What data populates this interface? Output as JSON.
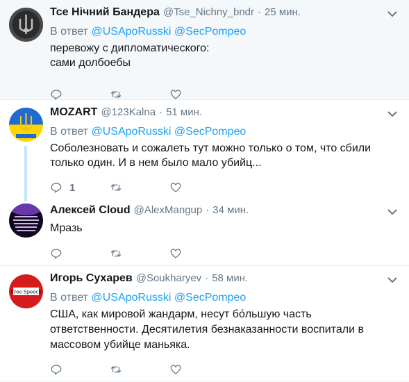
{
  "tweets": [
    {
      "name": "Тсе Нічний Бандера",
      "handle": "@Tse_Nichny_bndr",
      "time": "25 мин.",
      "reply_prefix": "В ответ",
      "mentions": [
        "@USApoRusski",
        "@SecPompeo"
      ],
      "text": "перевожу с дипломатического:\nсами долбоебы",
      "reply_count": "",
      "avatar": "dark-trident-avatar"
    },
    {
      "name": "MOZART",
      "handle": "@123Kalna",
      "time": "51 мин.",
      "reply_prefix": "В ответ",
      "mentions": [
        "@USApoRusski",
        "@SecPompeo"
      ],
      "text": "Соболезновать и сожалеть тут можно только о том, что сбили только один. И в нем было мало убийц...",
      "reply_count": "1",
      "avatar": "ukraine-flag-trident-avatar"
    },
    {
      "name": "Алексей Cloud",
      "handle": "@AlexMangup",
      "time": "34 мин.",
      "reply_prefix": "",
      "mentions": [],
      "text": "Мразь",
      "reply_count": "",
      "avatar": "purple-text-avatar"
    },
    {
      "name": "Игорь Сухарев",
      "handle": "@Soukharyev",
      "time": "58 мин.",
      "reply_prefix": "В ответ",
      "mentions": [
        "@USApoRusski",
        "@SecPompeo"
      ],
      "text": "США, как мировой жандарм, несут бо́льшую часть ответственности. Десятилетия безнаказанности воспитали в массовом убийце маньяка.",
      "reply_count": "",
      "avatar": "free-speech-avatar"
    }
  ],
  "colors": {
    "accent": "#1da1f2",
    "muted": "#657786",
    "highlight_bg": "#f5f8fa",
    "thread_line": "#c4e6fb"
  },
  "avatar_text": {
    "free_speech": "Free Speech"
  },
  "icons": [
    "reply-icon",
    "retweet-icon",
    "like-icon",
    "chevron-down-icon"
  ]
}
